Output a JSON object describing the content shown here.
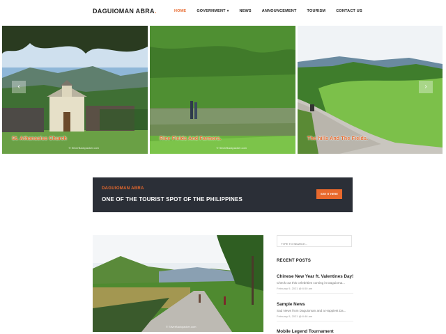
{
  "brand": {
    "name": "DAGUIOMAN ABRA",
    "dot": "."
  },
  "nav": [
    {
      "label": "HOME",
      "active": true
    },
    {
      "label": "GOVERNMENT",
      "dropdown": true
    },
    {
      "label": "NEWS"
    },
    {
      "label": "ANNOUNCEMENT"
    },
    {
      "label": "TOURISM"
    },
    {
      "label": "CONTACT US"
    }
  ],
  "slides": [
    {
      "caption": "St. Athanasius Church",
      "watermark": "© SilverBackpacker.com"
    },
    {
      "caption": "Rice Fields And Farmers.",
      "watermark": "© SilverBackpacker.com"
    },
    {
      "caption": "The hills And The Fields.",
      "watermark": ""
    }
  ],
  "banner": {
    "subtitle": "DAGUIOMAN ABRA",
    "title": "ONE OF THE TOURIST SPOT OF THE PHILIPPINES",
    "button": "SEE IT HERE"
  },
  "post_image": {
    "watermark": "© SilverBackpacker.com"
  },
  "sidebar": {
    "search_placeholder": "TYPE TO SEARCH...",
    "recent_posts_title": "RECENT POSTS",
    "posts": [
      {
        "title": "Chinese New Year ft. Valentines Day!",
        "excerpt": "Check out this celebrities coming in Daguioma...",
        "date": "February 9, 2021 @ 6:50 am"
      },
      {
        "title": "Sample News",
        "excerpt": "Sad News from Daguioman and a Happiest Da...",
        "date": "February 9, 2021 @ 6:46 am"
      },
      {
        "title": "Mobile Legend Tournament",
        "excerpt": "",
        "date": ""
      }
    ]
  },
  "colors": {
    "accent": "#e8692d",
    "banner_bg": "#2b2f37"
  }
}
